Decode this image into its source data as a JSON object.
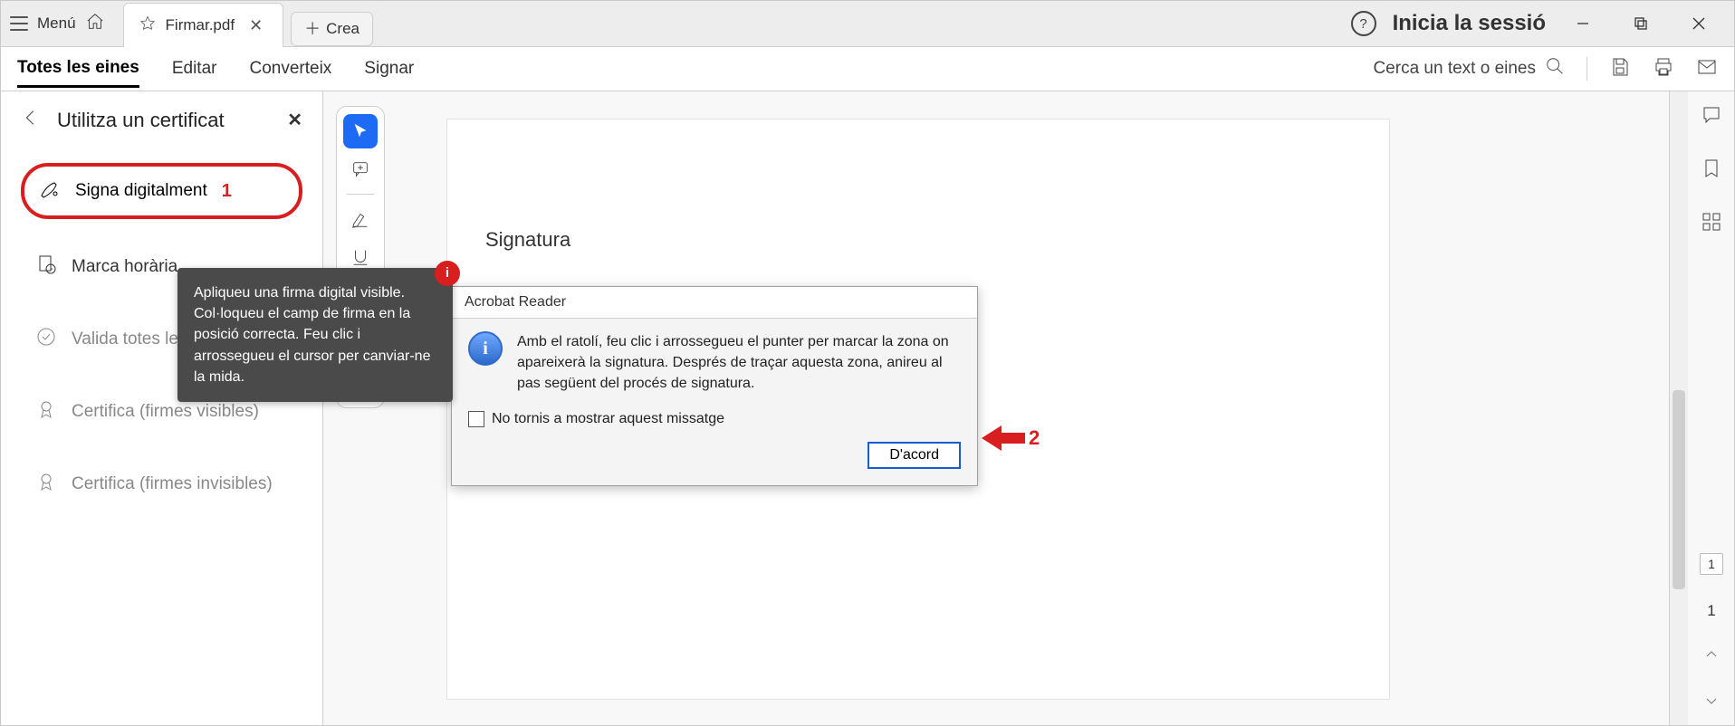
{
  "titlebar": {
    "menu_label": "Menú",
    "tab_title": "Firmar.pdf",
    "new_tab_label": "Crea",
    "login_label": "Inicia la sessió"
  },
  "toolbar": {
    "menus": {
      "all_tools": "Totes les eines",
      "edit": "Editar",
      "convert": "Converteix",
      "sign": "Signar"
    },
    "search_placeholder": "Cerca un text o eines"
  },
  "sidebar": {
    "panel_title": "Utilitza un certificat",
    "items": {
      "sign_digitally": "Signa digitalment",
      "timestamp": "Marca horària",
      "validate_all": "Valida totes les signatures",
      "certify_visible": "Certifica (firmes visibles)",
      "certify_invisible": "Certifica (firmes invisibles)"
    },
    "highlight_badge": "1"
  },
  "tooltip": {
    "text": "Apliqueu una firma digital visible. Col·loqueu el camp de firma en la posició correcta. Feu clic i arrossegueu el cursor per canviar-ne la mida.",
    "badge": "i"
  },
  "document": {
    "signature_heading": "Signatura"
  },
  "dialog": {
    "title": "Acrobat Reader",
    "message": "Amb el ratolí, feu clic i arrossegueu el punter per marcar la zona on apareixerà la signatura. Després de traçar aquesta zona, anireu al pas següent del procés de signatura.",
    "checkbox_label": "No tornis a mostrar aquest missatge",
    "ok_label": "D'acord",
    "arrow_badge": "2"
  },
  "pager": {
    "total_pages": "1",
    "current_page": "1"
  }
}
